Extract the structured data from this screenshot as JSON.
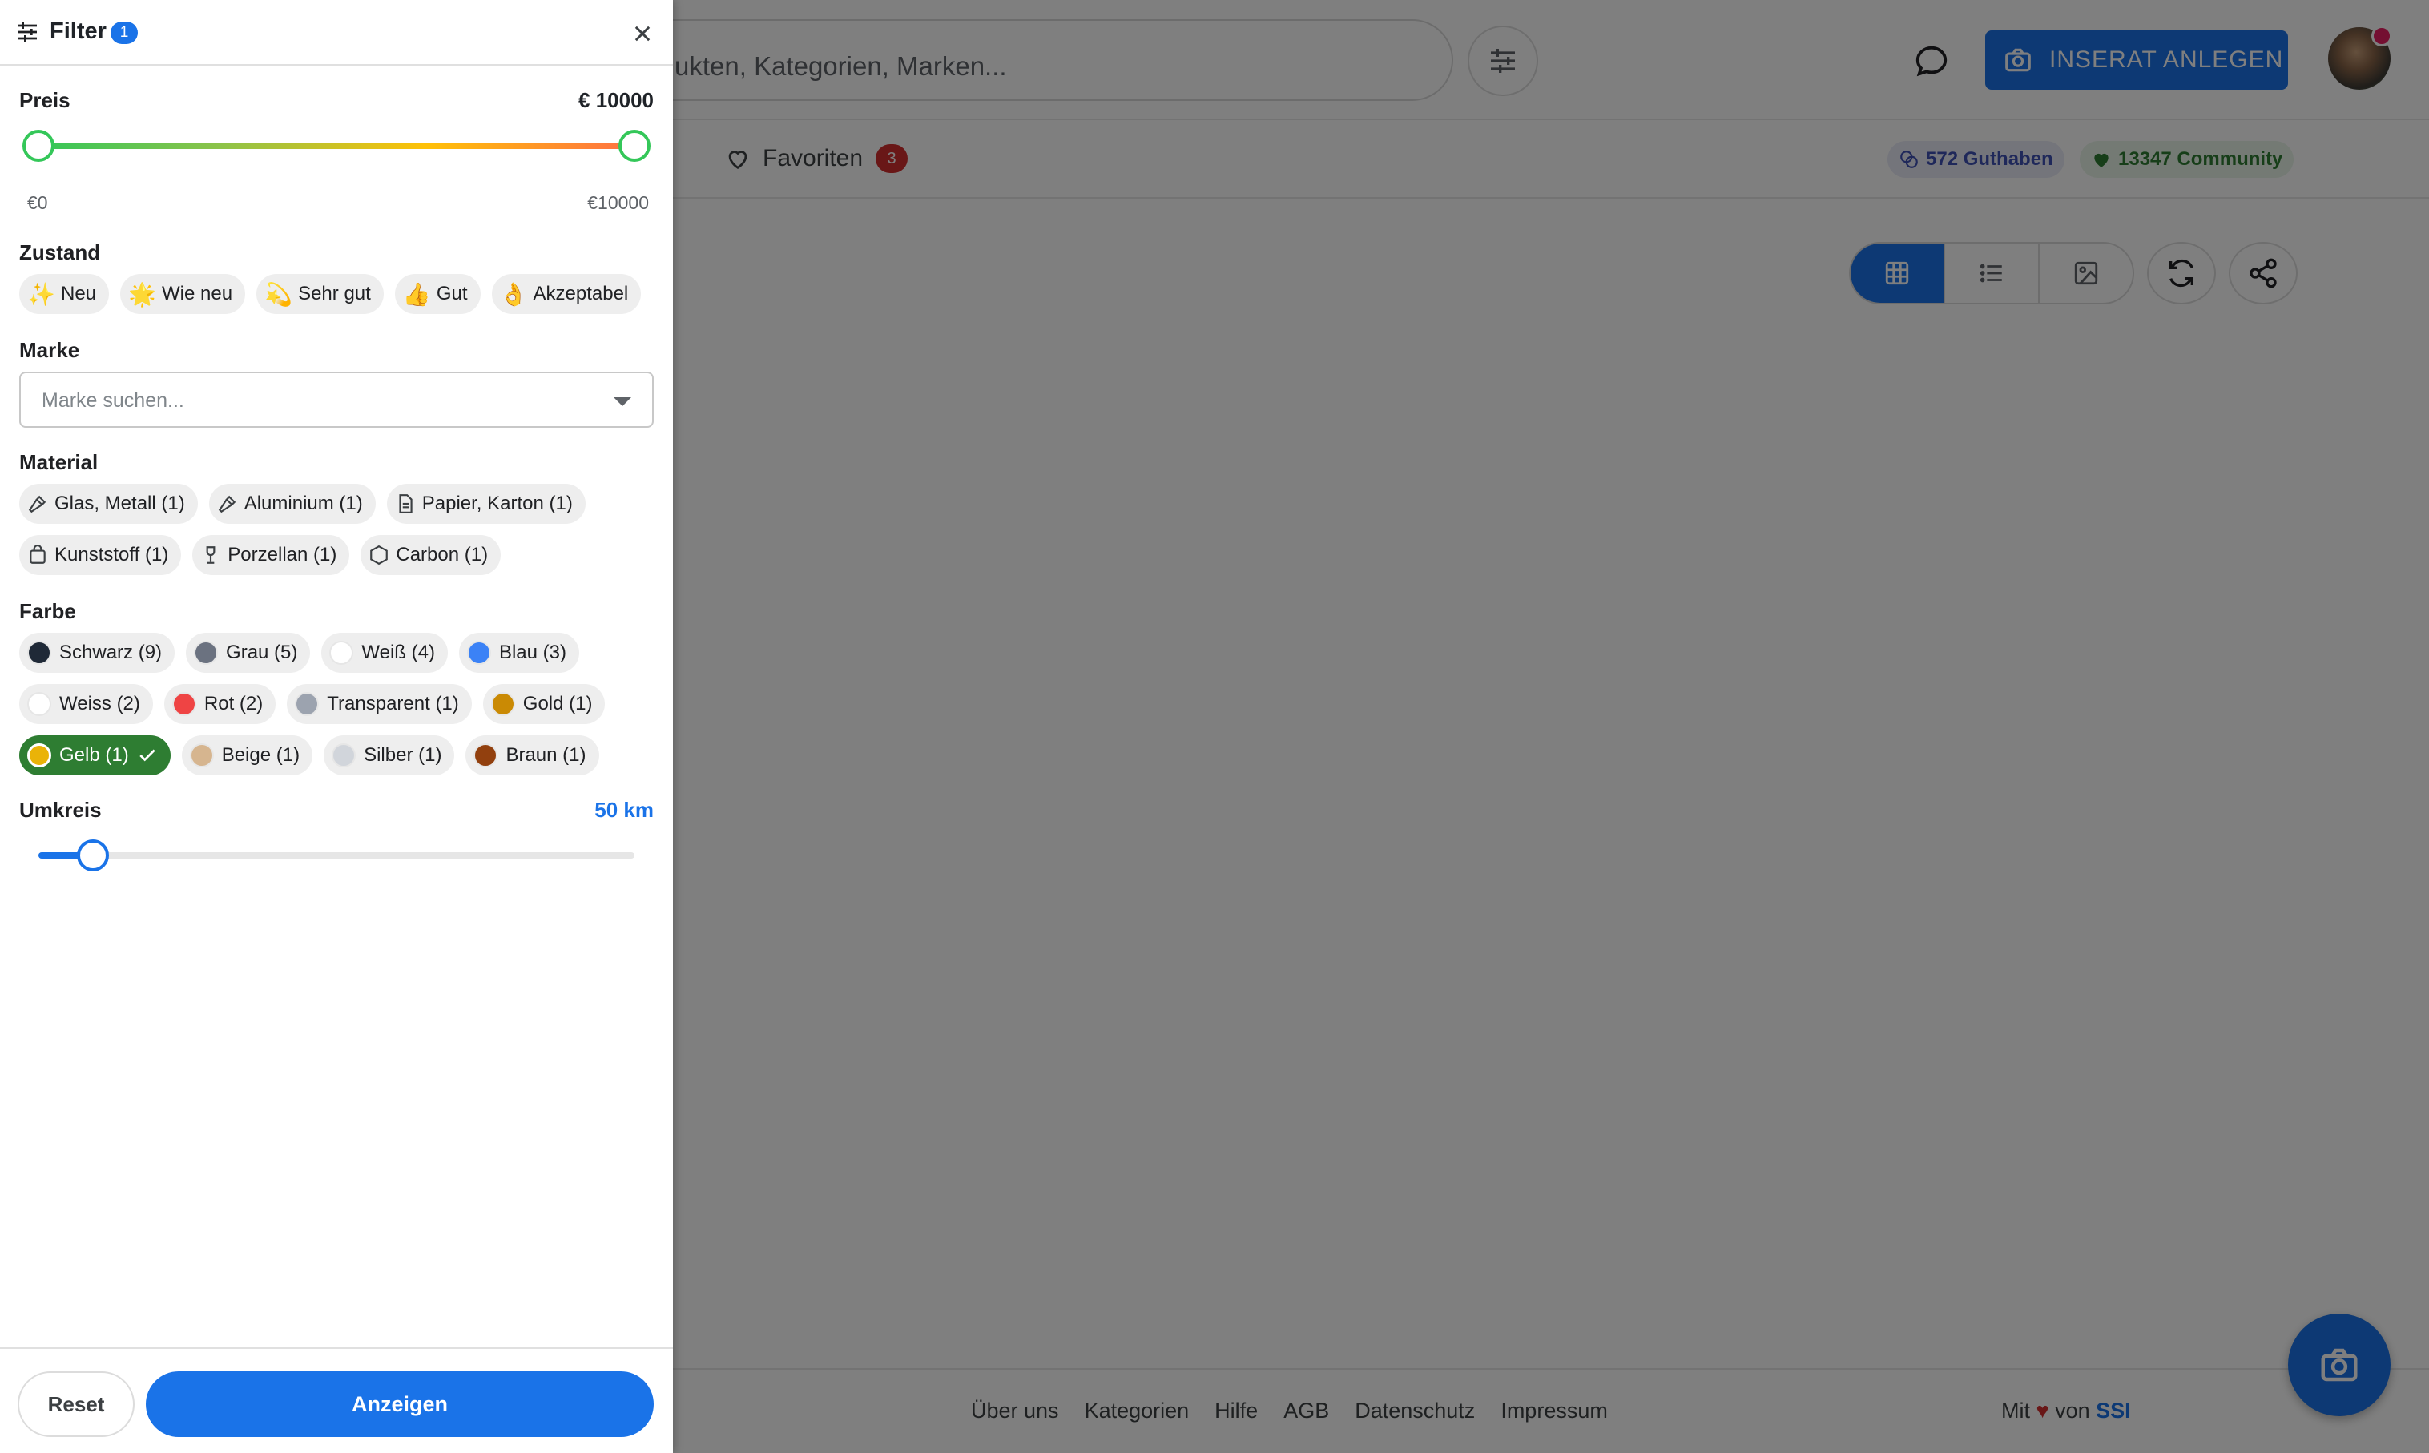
{
  "header": {
    "search_placeholder": "ukten, Kategorien, Marken...",
    "cta_label": "INSERAT ANLEGEN",
    "icons": {
      "filter": "tune-icon",
      "chat": "chat-bubble-icon",
      "camera": "camera-icon"
    }
  },
  "subnav": {
    "favorites_label": "Favoriten",
    "favorites_count": "3",
    "guthaben": "572 Guthaben",
    "community": "13347 Community"
  },
  "footer": {
    "links": [
      "Über uns",
      "Kategorien",
      "Hilfe",
      "AGB",
      "Datenschutz",
      "Impressum"
    ],
    "made_prefix": "Mit",
    "made_heart": "♥",
    "made_mid": "von",
    "made_brand": "SSI"
  },
  "filter": {
    "title": "Filter",
    "active_count": "1",
    "price": {
      "label": "Preis",
      "value": "€ 10000",
      "min_label": "€0",
      "max_label": "€10000",
      "range": [
        0,
        10000
      ],
      "selected": [
        0,
        10000
      ]
    },
    "condition": {
      "label": "Zustand",
      "options": [
        {
          "emoji": "✨",
          "label": "Neu"
        },
        {
          "emoji": "🌟",
          "label": "Wie neu"
        },
        {
          "emoji": "💫",
          "label": "Sehr gut"
        },
        {
          "emoji": "👍",
          "label": "Gut"
        },
        {
          "emoji": "👌",
          "label": "Akzeptabel"
        }
      ]
    },
    "brand": {
      "label": "Marke",
      "placeholder": "Marke suchen..."
    },
    "material": {
      "label": "Material",
      "options": [
        {
          "icon": "hammer-icon",
          "label": "Glas, Metall (1)"
        },
        {
          "icon": "hammer-icon",
          "label": "Aluminium (1)"
        },
        {
          "icon": "document-icon",
          "label": "Papier, Karton (1)"
        },
        {
          "icon": "bag-icon",
          "label": "Kunststoff (1)"
        },
        {
          "icon": "porcelain-icon",
          "label": "Porzellan (1)"
        },
        {
          "icon": "hexagon-icon",
          "label": "Carbon (1)"
        }
      ]
    },
    "color": {
      "label": "Farbe",
      "options": [
        {
          "label": "Schwarz (9)",
          "swatch": "#1f2937"
        },
        {
          "label": "Grau (5)",
          "swatch": "#6b7280"
        },
        {
          "label": "Weiß (4)",
          "swatch": "#ffffff"
        },
        {
          "label": "Blau (3)",
          "swatch": "#3b82f6"
        },
        {
          "label": "Weiss (2)",
          "swatch": "#ffffff"
        },
        {
          "label": "Rot (2)",
          "swatch": "#ef4444"
        },
        {
          "label": "Transparent (1)",
          "swatch": "#9ca3af"
        },
        {
          "label": "Gold (1)",
          "swatch": "#ca8a04"
        },
        {
          "label": "Gelb (1)",
          "swatch": "#eab308",
          "selected": true
        },
        {
          "label": "Beige (1)",
          "swatch": "#d6b58f"
        },
        {
          "label": "Silber (1)",
          "swatch": "#d1d5db"
        },
        {
          "label": "Braun (1)",
          "swatch": "#92400e"
        }
      ]
    },
    "radius": {
      "label": "Umkreis",
      "value": "50 km"
    },
    "reset_label": "Reset",
    "apply_label": "Anzeigen"
  },
  "colors": {
    "accent": "#1a73e8",
    "selected_chip": "#2e7d32",
    "badge_red": "#d32f2f"
  }
}
